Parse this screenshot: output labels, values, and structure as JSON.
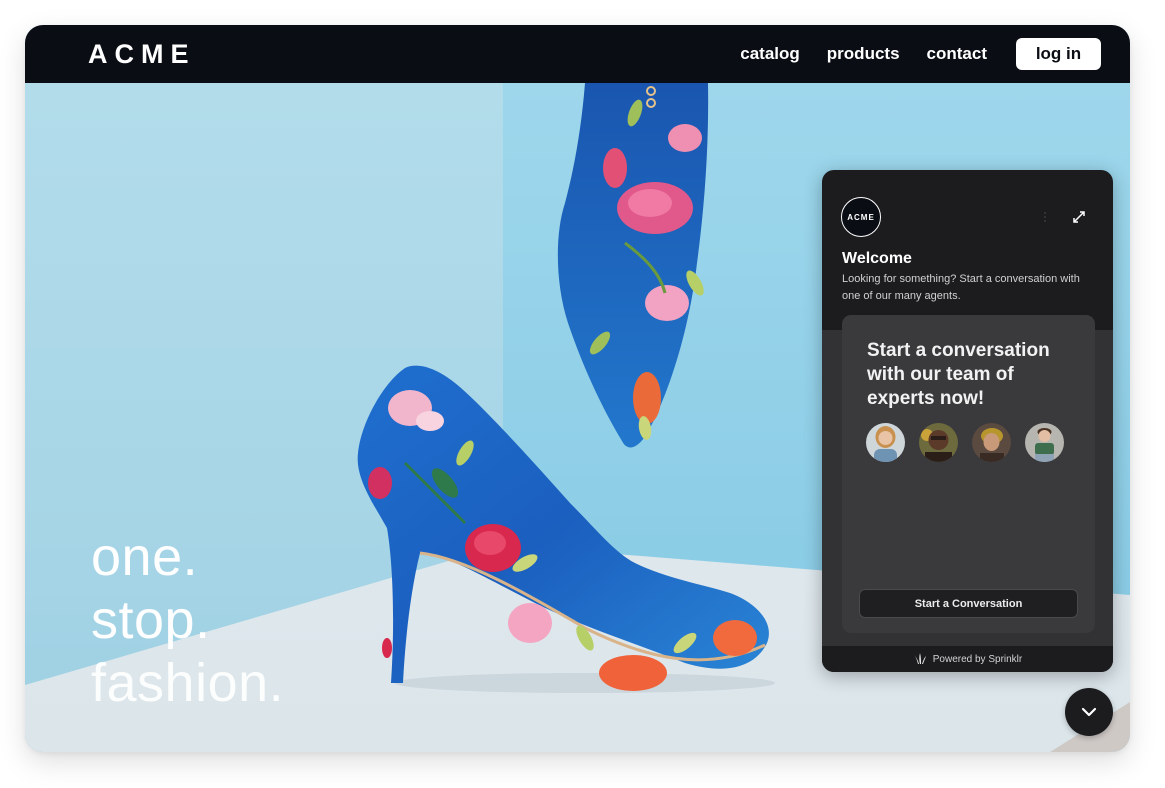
{
  "nav": {
    "logo": "ACME",
    "links": [
      "catalog",
      "products",
      "contact"
    ],
    "login_label": "log in"
  },
  "hero": {
    "tagline": [
      "one.",
      "stop.",
      "fashion."
    ],
    "image_description": "blue floral high heel pumps against light blue wall"
  },
  "chat": {
    "brand_badge": "ACME",
    "menu_icon": "more-vertical-icon",
    "expand_icon": "expand-icon",
    "welcome_title": "Welcome",
    "welcome_subtitle": "Looking for something? Start a conversation with one of our many agents.",
    "card_title": "Start a conversation with our team of experts now!",
    "agents": [
      {
        "name": "agent-1",
        "skin": "#e8c3a6",
        "hair": "#c9914f",
        "shirt": "#6f93b3"
      },
      {
        "name": "agent-2",
        "skin": "#5b3a2a",
        "hair": "#2b1e18",
        "shirt": "#6e8a43"
      },
      {
        "name": "agent-3",
        "skin": "#c99a7a",
        "hair": "#5a3a26",
        "shirt": "#3a2a24"
      },
      {
        "name": "agent-4",
        "skin": "#e2bfa4",
        "hair": "#4c3424",
        "shirt": "#3f6e4e"
      }
    ],
    "start_button_label": "Start a Conversation",
    "footer_text": "Powered by Sprinklr"
  },
  "collapse_button_icon": "chevron-down-icon",
  "colors": {
    "nav_bg": "#0b0d15",
    "chat_bg": "#1c1c1e",
    "chat_card_bg": "#3a3a3c",
    "hero_wall": "#a9d8e8"
  }
}
